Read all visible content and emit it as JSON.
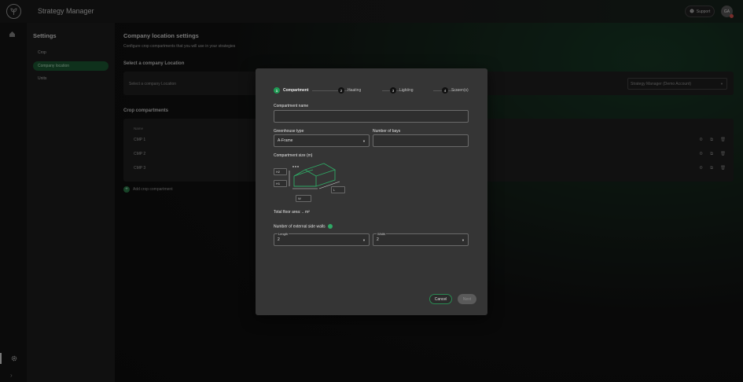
{
  "app": {
    "title": "Strategy Manager"
  },
  "topbar": {
    "support_label": "Support",
    "avatar_initials": "GA"
  },
  "sidebar": {
    "title": "Settings",
    "items": [
      {
        "label": "Crop"
      },
      {
        "label": "Company location"
      },
      {
        "label": "Units"
      }
    ]
  },
  "main": {
    "title": "Company location settings",
    "subtitle": "Configure crop compartments that you will use in your strategies",
    "select_location_label": "Select a company Location",
    "select_location_placeholder": "Select a company Location",
    "account_select_value": "Strategy Manager (Demo Account)",
    "compartments_label": "Crop compartments",
    "table_header_name": "Name",
    "rows": [
      {
        "name": "CMP 1"
      },
      {
        "name": "CMP 2"
      },
      {
        "name": "CMP 3"
      }
    ],
    "add_compartment_label": "Add crop compartment"
  },
  "modal": {
    "steps": [
      {
        "num": "1",
        "label": "Compartment"
      },
      {
        "num": "2",
        "label": "Heating"
      },
      {
        "num": "3",
        "label": "Lighting"
      },
      {
        "num": "4",
        "label": "Screen(s)"
      }
    ],
    "compartment_name_label": "Compartment name",
    "compartment_name_value": "",
    "greenhouse_type_label": "Greenhouse type",
    "greenhouse_type_value": "A-Frame",
    "number_of_bays_label": "Number of bays",
    "number_of_bays_value": "",
    "compartment_size_label": "Compartment size (m)",
    "dim_h2": "H2",
    "dim_h1": "H1",
    "dim_w": "W",
    "dim_l": "L",
    "total_floor_area": "Total floor area: .. m²",
    "external_walls_label": "Number of external side walls",
    "length_label": "Length",
    "length_value": "2",
    "width_label": "Width",
    "width_value": "2",
    "cancel_label": "Cancel",
    "next_label": "Next"
  },
  "colors": {
    "accent": "#1f9a54",
    "active_nav": "#1d5a34"
  }
}
